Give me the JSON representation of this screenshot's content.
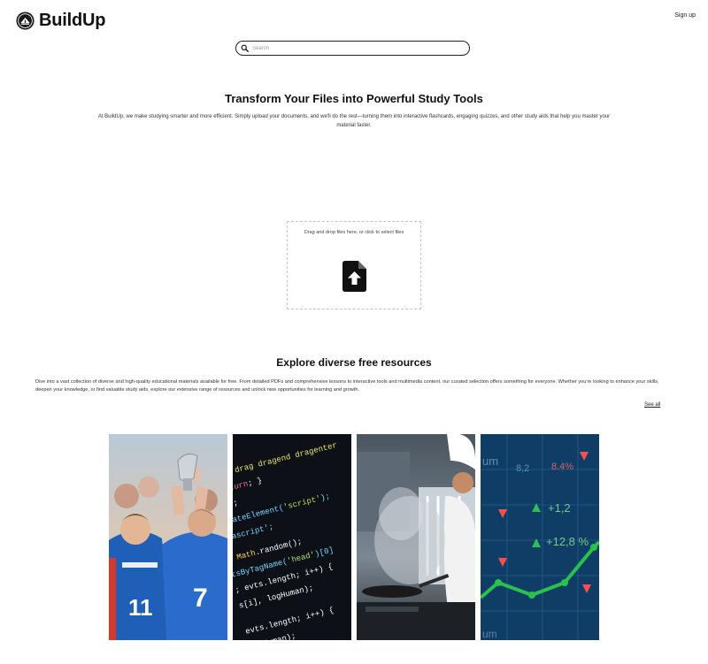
{
  "header": {
    "brand": "BuildUp",
    "logo_icon": "buildup-logo-icon",
    "signup_label": "Sign up"
  },
  "search": {
    "placeholder": "Search",
    "value": "",
    "icon": "search-icon"
  },
  "hero": {
    "title": "Transform Your Files into Powerful Study Tools",
    "description": "At BuildUp, we make studying smarter and more efficient. Simply upload your documents, and we'll do the rest—turning them into interactive flashcards, engaging quizzes, and other study aids that help you master your material faster."
  },
  "dropzone": {
    "instruction": "Drag and drop files here, or click to select files",
    "icon": "file-upload-icon"
  },
  "resources": {
    "title": "Explore diverse free resources",
    "description": "Dive into a vast collection of diverse and high-quality educational materials available for free. From detailed PDFs and comprehensive lessons to interactive tools and multimedia content, our curated selection offers something for everyone. Whether you're looking to enhance your skills, deepen your knowledge, or find valuable study aids, explore our extensive range of resources and unlock new opportunities for learning and growth.",
    "see_all_label": "See all",
    "cards": [
      {
        "image": "sports-team-trophy-image"
      },
      {
        "image": "javascript-code-image"
      },
      {
        "image": "chef-cooking-image"
      },
      {
        "image": "stock-market-chart-image"
      }
    ]
  },
  "colors": {
    "text": "#111111",
    "border": "#222222",
    "dropzone_border": "#c4c4c4",
    "market_green": "#29c24a"
  }
}
